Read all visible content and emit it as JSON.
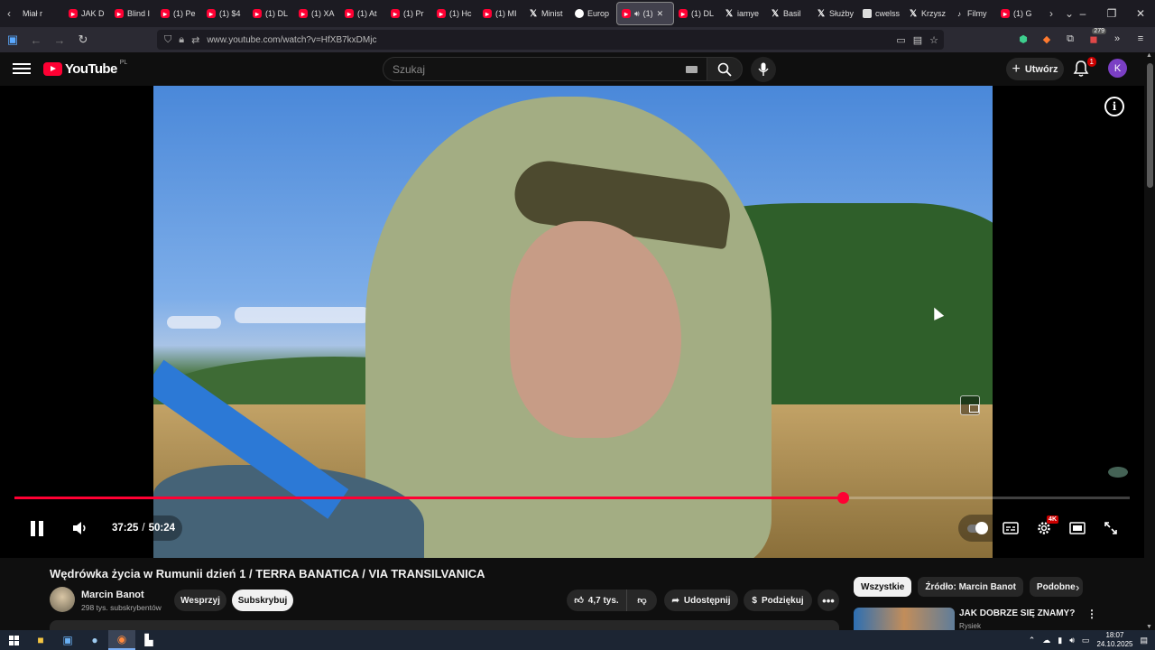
{
  "browser": {
    "tabs": [
      {
        "label": "Miał r",
        "icon": "none"
      },
      {
        "label": "JAK D",
        "icon": "youtube"
      },
      {
        "label": "Blind I",
        "icon": "youtube"
      },
      {
        "label": "(1) Pe",
        "icon": "youtube"
      },
      {
        "label": "(1) $4",
        "icon": "youtube"
      },
      {
        "label": "(1) DL",
        "icon": "youtube"
      },
      {
        "label": "(1) XA",
        "icon": "youtube"
      },
      {
        "label": "(1) At",
        "icon": "youtube"
      },
      {
        "label": "(1) Pr",
        "icon": "youtube"
      },
      {
        "label": "(1) Hc",
        "icon": "youtube"
      },
      {
        "label": "(1) MI",
        "icon": "youtube"
      },
      {
        "label": "Minist",
        "icon": "x"
      },
      {
        "label": "Europ",
        "icon": "globe"
      },
      {
        "label": "(1)",
        "icon": "youtube",
        "active": true
      },
      {
        "label": "(1) DL",
        "icon": "youtube"
      },
      {
        "label": "iamye",
        "icon": "x"
      },
      {
        "label": "Basil",
        "icon": "x"
      },
      {
        "label": "Służby",
        "icon": "x"
      },
      {
        "label": "cwelss",
        "icon": "doc"
      },
      {
        "label": "Krzysz",
        "icon": "x"
      },
      {
        "label": "Filmy",
        "icon": "tiktok"
      },
      {
        "label": "(1) G",
        "icon": "youtube"
      }
    ],
    "url": "www.youtube.com/watch?v=HfXB7kxDMjc",
    "extension_badge": "279"
  },
  "youtube": {
    "logo_text": "YouTube",
    "country_code": "PL",
    "search_placeholder": "Szukaj",
    "create_label": "Utwórz",
    "notification_count": "1",
    "avatar_letter": "K"
  },
  "player": {
    "current_time": "37:25",
    "separator": "/",
    "duration": "50:24",
    "progress_fraction": 0.743,
    "quality_badge": "4K",
    "accent_color": "#ff0033"
  },
  "video": {
    "title": "Wędrówka życia w Rumunii dzień 1 / TERRA BANATICA / VIA TRANSILVANICA",
    "channel_name": "Marcin Banot",
    "subscribers": "298 tys. subskrybentów",
    "support_label": "Wesprzyj",
    "subscribe_label": "Subskrybuj",
    "likes": "4,7 tys.",
    "share_label": "Udostępnij",
    "thanks_label": "Podziękuj"
  },
  "sidebar": {
    "chips": [
      {
        "label": "Wszystkie",
        "active": true
      },
      {
        "label": "Źródło: Marcin Banot",
        "active": false
      },
      {
        "label": "Podobne",
        "active": false
      }
    ],
    "recommendation": {
      "title": "JAK DOBRZE SIĘ ZNAMY?",
      "channel": "Rysiek"
    }
  },
  "taskbar": {
    "time": "18:07",
    "date": "24.10.2025"
  }
}
